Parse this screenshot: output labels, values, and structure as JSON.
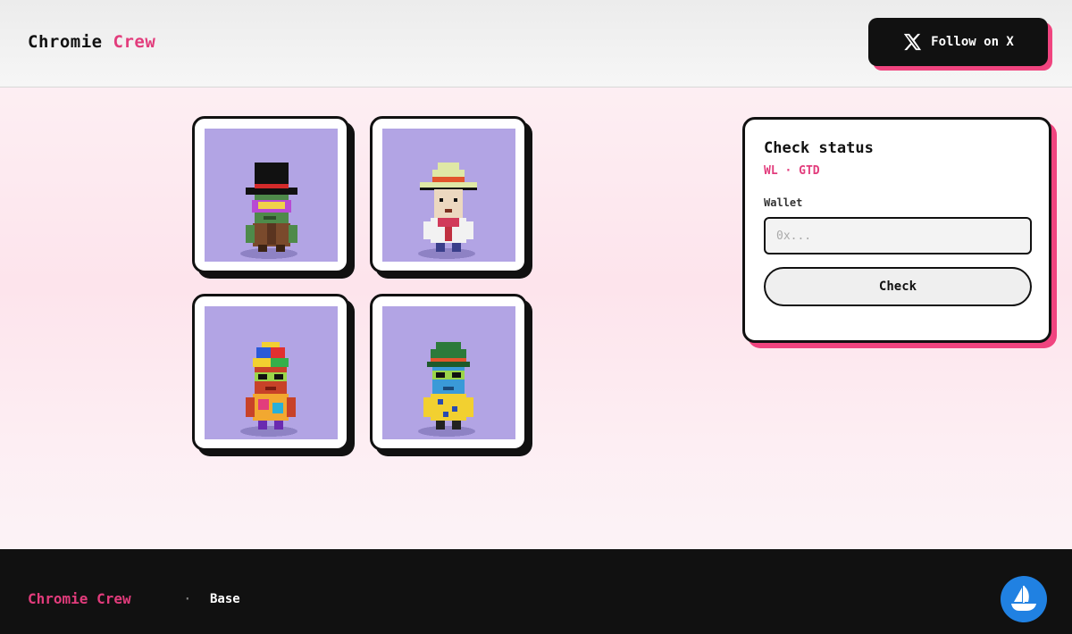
{
  "header": {
    "brand_part1": "Chromie",
    "brand_part2": "Crew",
    "follow_label": "Follow on X"
  },
  "gallery": {
    "items": [
      {
        "name": "character-top-hat",
        "icon": "pixel-character-icon"
      },
      {
        "name": "character-sombrero",
        "icon": "pixel-character-icon"
      },
      {
        "name": "character-propeller-cap",
        "icon": "pixel-character-icon"
      },
      {
        "name": "character-bowler-hat",
        "icon": "pixel-character-icon"
      }
    ],
    "background_color": "#b2a4e4"
  },
  "status_panel": {
    "title": "Check status",
    "tags": "WL · GTD",
    "wallet_label": "Wallet",
    "wallet_placeholder": "0x...",
    "wallet_value": "",
    "check_label": "Check"
  },
  "footer": {
    "brand": "Chromie Crew",
    "separator": "·",
    "chain": "Base",
    "marketplace_icon": "opensea-icon"
  },
  "colors": {
    "accent": "#e23c7c",
    "shadow_pink": "#f0447f",
    "dark": "#111111",
    "opensea_blue": "#2081e2"
  }
}
